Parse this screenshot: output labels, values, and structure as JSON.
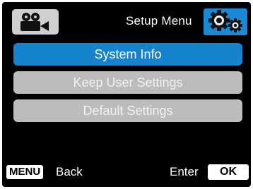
{
  "header": {
    "title": "Setup Menu",
    "mode_icon": "video-camera-icon",
    "settings_icon": "gears-icon"
  },
  "menu": {
    "items": [
      {
        "label": "System Info",
        "selected": true
      },
      {
        "label": "Keep User Settings",
        "selected": false
      },
      {
        "label": "Default Settings",
        "selected": false
      }
    ]
  },
  "footer": {
    "menu_key": "MENU",
    "back_label": "Back",
    "enter_label": "Enter",
    "ok_key": "OK"
  },
  "colors": {
    "accent": "#1683cf",
    "inactive": "#bcbcbc",
    "background": "#000000"
  }
}
